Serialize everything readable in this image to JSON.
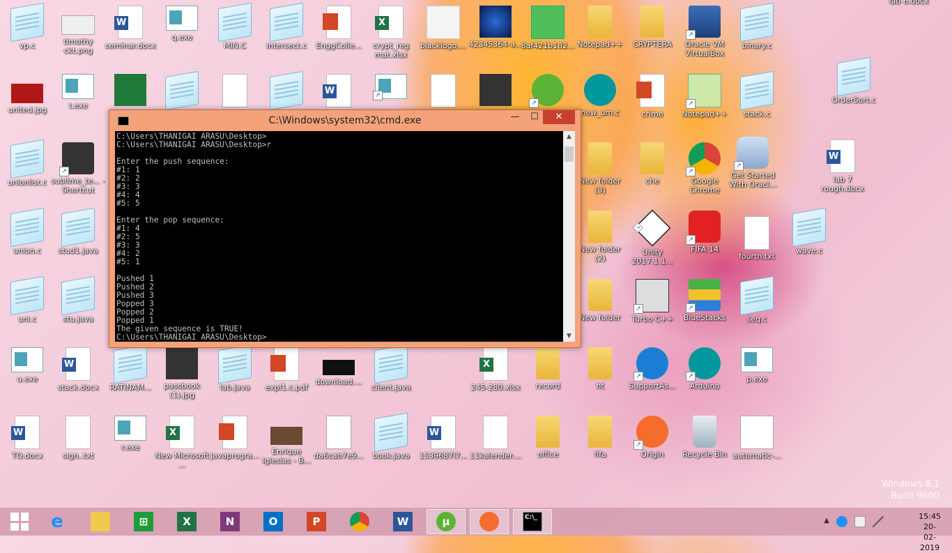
{
  "desktop": {
    "icons": [
      {
        "label": "vp.c"
      },
      {
        "label": "timothy ckt.png"
      },
      {
        "label": "seminar.docx"
      },
      {
        "label": "q.exe"
      },
      {
        "label": "MIN.C"
      },
      {
        "label": "intersect.c"
      },
      {
        "label": "EnggColle..."
      },
      {
        "label": "crypt_reg mat.xlsx"
      },
      {
        "label": "blacklogo...."
      },
      {
        "label": "42345364-a..."
      },
      {
        "label": "8af421b182..."
      },
      {
        "label": "Notepad++"
      },
      {
        "label": "CRYPTERA"
      },
      {
        "label": "Oracle VM VirtualBox"
      },
      {
        "label": "binary.c"
      },
      {
        "label": "lab 6.docx"
      },
      {
        "label": "united.jpg"
      },
      {
        "label": "t.exe"
      },
      {
        "label": "new_um.c"
      },
      {
        "label": "crime"
      },
      {
        "label": "Notepad++"
      },
      {
        "label": "stack.c"
      },
      {
        "label": "OrderSort.c"
      },
      {
        "label": "unionlist.c"
      },
      {
        "label": "sublime_te... - Shortcut"
      },
      {
        "label": "New folder (3)"
      },
      {
        "label": "che"
      },
      {
        "label": "Google Chrome"
      },
      {
        "label": "Get Started With Oracl..."
      },
      {
        "label": "lab 7 rough.docx"
      },
      {
        "label": "union.c"
      },
      {
        "label": "stud1.java"
      },
      {
        "label": "New folder (2)"
      },
      {
        "label": "Unity 2017.1.1..."
      },
      {
        "label": "FIFA 14"
      },
      {
        "label": "fourth.txt"
      },
      {
        "label": "wave.c"
      },
      {
        "label": "uni.c"
      },
      {
        "label": "stu.java"
      },
      {
        "label": "New folder"
      },
      {
        "label": "Turbo C++"
      },
      {
        "label": "BlueStacks"
      },
      {
        "label": "seq.c"
      },
      {
        "label": "u.exe"
      },
      {
        "label": "stack.docx"
      },
      {
        "label": "RATINAM..."
      },
      {
        "label": "passbook (1).jpg"
      },
      {
        "label": "lab.java"
      },
      {
        "label": "expl1.c.pdf"
      },
      {
        "label": "download...."
      },
      {
        "label": "client.java"
      },
      {
        "label": "245-280.xlsx"
      },
      {
        "label": "record"
      },
      {
        "label": "ht"
      },
      {
        "label": "SupportAs..."
      },
      {
        "label": "Arduino"
      },
      {
        "label": "p.exe"
      },
      {
        "label": "TO.docx"
      },
      {
        "label": "sign..txt"
      },
      {
        "label": "r.exe"
      },
      {
        "label": "New Microsoft ..."
      },
      {
        "label": "javaprogra..."
      },
      {
        "label": "Enrique Iglesias - B..."
      },
      {
        "label": "da6cab7e9..."
      },
      {
        "label": "book.java"
      },
      {
        "label": "1539687l7..."
      },
      {
        "label": "11kalender...."
      },
      {
        "label": "office"
      },
      {
        "label": "fifa"
      },
      {
        "label": "Origin"
      },
      {
        "label": "Recycle Bin"
      },
      {
        "label": "automatic-..."
      }
    ]
  },
  "cmd": {
    "title": "C:\\Windows\\system32\\cmd.exe",
    "minimize": "—",
    "maximize": "☐",
    "close": "✕",
    "output": "C:\\Users\\THANIGAI ARASU\\Desktop>\nC:\\Users\\THANIGAI ARASU\\Desktop>r\n\nEnter the push sequence:\n#1: 1\n#2: 2\n#3: 3\n#4: 4\n#5: 5\n\nEnter the pop sequence:\n#1: 4\n#2: 5\n#3: 3\n#4: 2\n#5: 1\n\nPushed 1\nPushed 2\nPushed 3\nPopped 3\nPopped 2\nPopped 1\nThe given sequence is TRUE!\nC:\\Users\\THANIGAI ARASU\\Desktop>"
  },
  "watermark": {
    "line1": "Windows 8.1",
    "line2": "Build 9600"
  },
  "taskbar": {
    "items": [
      {
        "icon": "windows-start-icon"
      },
      {
        "icon": "internet-explorer-icon"
      },
      {
        "icon": "file-explorer-icon"
      },
      {
        "icon": "store-icon"
      },
      {
        "icon": "excel-icon"
      },
      {
        "icon": "onenote-icon"
      },
      {
        "icon": "outlook-icon"
      },
      {
        "icon": "powerpoint-icon"
      },
      {
        "icon": "chrome-icon"
      },
      {
        "icon": "word-icon"
      },
      {
        "icon": "utorrent-icon"
      },
      {
        "icon": "origin-icon"
      },
      {
        "icon": "cmd-icon"
      }
    ],
    "clock": {
      "time": "15:45",
      "date": "20-02-2019"
    }
  },
  "colors": {
    "cmd_frame": "#f3a27a",
    "close": "#c7402f",
    "taskbar": "#d6a0b2"
  }
}
